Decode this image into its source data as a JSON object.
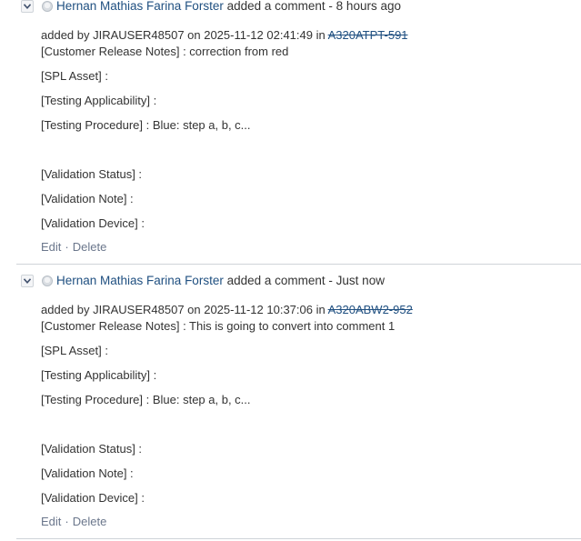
{
  "comments": [
    {
      "author": "Hernan Mathias Farina Forster",
      "action": "added a comment - ",
      "time": "8 hours ago",
      "meta_prefix": "added by JIRAUSER48507 on 2025-11-12 02:41:49 in ",
      "issue_key": "A320ATPT-591",
      "fields": [
        "[Customer Release Notes] : correction from red",
        "[SPL Asset] :",
        "[Testing Applicability] :",
        "[Testing Procedure] : Blue: step a, b, c...",
        "[Validation Status] :",
        "[Validation Note] :",
        "[Validation Device] :"
      ],
      "edit_label": "Edit",
      "separator": "·",
      "delete_label": "Delete"
    },
    {
      "author": "Hernan Mathias Farina Forster",
      "action": "added a comment - ",
      "time": "Just now",
      "meta_prefix": "added by JIRAUSER48507 on 2025-11-12 10:37:06 in ",
      "issue_key": "A320ABW2-952",
      "fields": [
        "[Customer Release Notes] : This is going to convert into comment 1",
        "[SPL Asset] :",
        "[Testing Applicability] :",
        "[Testing Procedure] : Blue: step a, b, c...",
        "[Validation Status] :",
        "[Validation Note] :",
        "[Validation Device] :"
      ],
      "edit_label": "Edit",
      "separator": "·",
      "delete_label": "Delete"
    }
  ]
}
